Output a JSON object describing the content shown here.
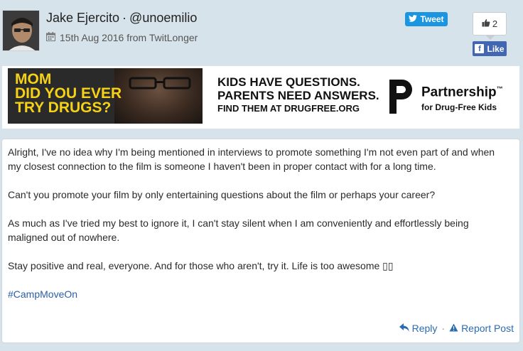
{
  "header": {
    "author_name": "Jake Ejercito",
    "separator": "·",
    "handle": "@unoemilio",
    "date": "15th Aug 2016 from TwitLonger",
    "tweet_label": "Tweet",
    "like_count": "2",
    "fb_like_label": "Like",
    "fb_logo_letter": "f"
  },
  "ad": {
    "headline": "MOM\nDID YOU EVER\nTRY DRUGS?",
    "line1": "KIDS HAVE QUESTIONS.",
    "line2": "PARENTS NEED ANSWERS.",
    "line3": "FIND THEM AT DRUGFREE.ORG",
    "brand": "Partnership",
    "brand_tm": "™",
    "brand_sub": "for Drug-Free Kids"
  },
  "post": {
    "paragraphs": [
      "Alright, I've no idea why I'm being mentioned in interviews to promote something I'm not even part of and when my closest connection to the film is someone I haven't been in proper contact with for a long time.",
      "Can't you promote your film by only entertaining questions about the film or perhaps your career?",
      "As much as I've tried my best to ignore it, I can't stay silent when I am conveniently and effortlessly being maligned out of nowhere.",
      "Stay positive and real, everyone. And for those who aren't, try it. Life is too awesome ▯▯"
    ],
    "hashtag": "#CampMoveOn",
    "reply_label": "Reply",
    "action_separator": "·",
    "report_label": "Report Post"
  },
  "icons": {
    "calendar": "calendar-icon",
    "twitter": "twitter-bird-icon",
    "thumbs": "thumbs-up-icon",
    "reply": "reply-arrow-icon",
    "warning": "warning-icon"
  },
  "colors": {
    "page_bg": "#d7e3ea",
    "twitter_blue": "#1b95e0",
    "facebook_blue": "#4267b2",
    "link_blue": "#2b6cb0",
    "ad_yellow": "#f5d117"
  }
}
